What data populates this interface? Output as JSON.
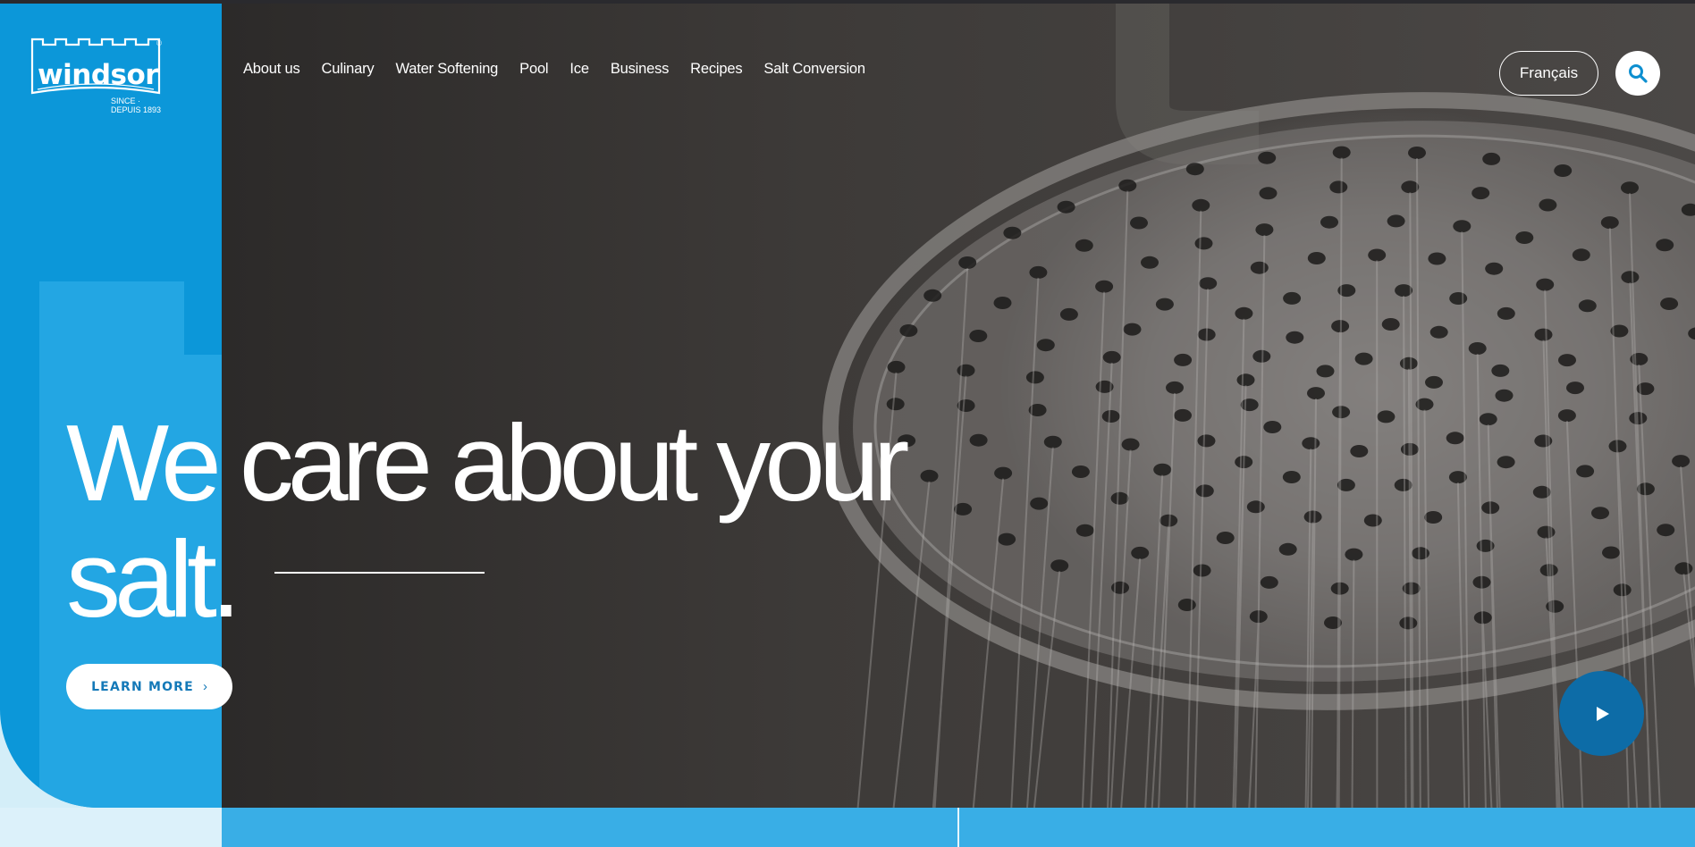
{
  "brand": {
    "logo_text": "windsor",
    "since": "SINCE · DEPUIS 1893",
    "registered": "®",
    "color_blue": "#0c97d9"
  },
  "nav": {
    "items": [
      {
        "label": "About us"
      },
      {
        "label": "Culinary"
      },
      {
        "label": "Water Softening"
      },
      {
        "label": "Pool"
      },
      {
        "label": "Ice"
      },
      {
        "label": "Business"
      },
      {
        "label": "Recipes"
      },
      {
        "label": "Salt Conversion"
      }
    ]
  },
  "header": {
    "language_button": "Français",
    "search_icon": "search-icon"
  },
  "hero": {
    "headline_line1": "We care about your",
    "headline_line2": "salt.",
    "cta_label": "LEARN MORE",
    "cta_chevron": "›",
    "play_icon": "play-icon",
    "background": "shower head with water streams"
  }
}
